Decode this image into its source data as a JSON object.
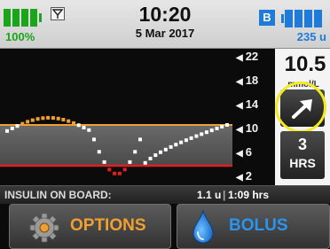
{
  "status_bar": {
    "battery_label": "100%",
    "time": "10:20",
    "date": "5 Mar 2017",
    "badge": "B",
    "reservoir_label": "235 u",
    "battery_level": 1.0,
    "colors": {
      "battery": "#1aa51a",
      "reservoir": "#1e7bd9"
    }
  },
  "graph": {
    "y_ticks": [
      "22",
      "18",
      "14",
      "10",
      "6",
      "2"
    ],
    "high_limit": 10,
    "low_limit": 3,
    "colors": {
      "high_line": "#f0a030",
      "low_line": "#e02020",
      "in_range": "#ffffff",
      "above": "#f0a030",
      "below": "#e02020"
    }
  },
  "current_bg": {
    "value": "10.5",
    "unit": "mmol/L",
    "trend_icon": "arrow-up-right-icon"
  },
  "time_range": {
    "value": "3",
    "unit": "HRS"
  },
  "iob": {
    "label": "INSULIN ON BOARD:",
    "amount": "1.1 u",
    "separator": "|",
    "duration": "1:09 hrs"
  },
  "buttons": {
    "options_label": "OPTIONS",
    "bolus_label": "BOLUS",
    "colors": {
      "options": "#f0a030",
      "bolus": "#2a95f0"
    }
  }
}
